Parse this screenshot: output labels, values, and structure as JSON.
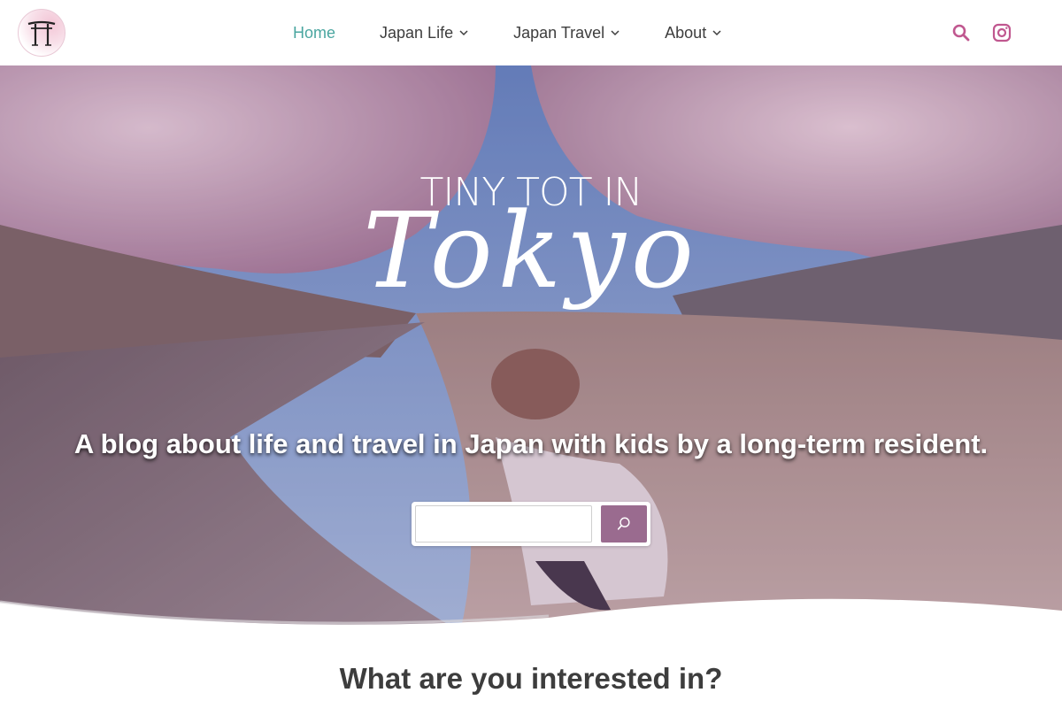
{
  "header": {
    "logo_text": "TT",
    "nav": [
      {
        "label": "Home",
        "active": true,
        "has_dropdown": false
      },
      {
        "label": "Japan Life",
        "active": false,
        "has_dropdown": true
      },
      {
        "label": "Japan Travel",
        "active": false,
        "has_dropdown": true
      },
      {
        "label": "About",
        "active": false,
        "has_dropdown": true
      }
    ],
    "icons": [
      "search-icon",
      "instagram-icon"
    ]
  },
  "hero": {
    "brand_line1": "TINY TOT IN",
    "brand_line2": "Tokyo",
    "tagline": "A blog about life and travel in Japan with kids by a long-term resident.",
    "search": {
      "placeholder": "",
      "value": ""
    }
  },
  "main": {
    "section_title": "What are you interested in?"
  },
  "colors": {
    "accent_teal": "#4aa6a0",
    "brand_mauve": "#9a6b8f",
    "icon_pink": "#c0578f",
    "text_dark": "#3d3d3d"
  }
}
